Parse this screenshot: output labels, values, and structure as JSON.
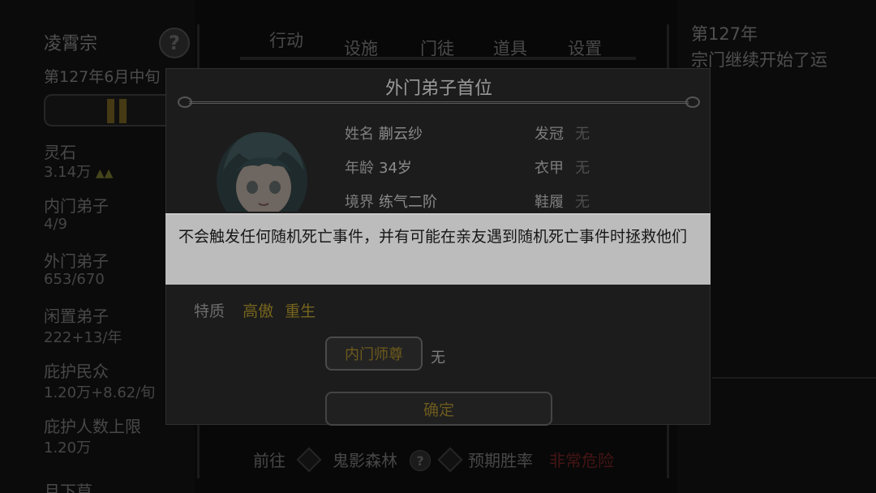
{
  "sidebar": {
    "sect_name": "凌霄宗",
    "date": "第127年6月中旬",
    "stats": [
      {
        "label": "灵石",
        "value": "3.14万",
        "trend": "▲▲"
      },
      {
        "label": "内门弟子",
        "value": "4/9"
      },
      {
        "label": "外门弟子",
        "value": "653/670"
      },
      {
        "label": "闲置弟子",
        "value": "222+13/年"
      },
      {
        "label": "庇护民众",
        "value": "1.20万+8.62/旬"
      },
      {
        "label": "庇护人数上限",
        "value": "1.20万"
      },
      {
        "label": "月下草",
        "value": ""
      }
    ]
  },
  "nav": {
    "tabs": [
      "行动",
      "设施",
      "门徒",
      "道具",
      "设置"
    ]
  },
  "log": {
    "title": "第127年",
    "message": "宗门继续开始了运"
  },
  "bottom": {
    "go_label": "前往",
    "location": "鬼影森林",
    "win_rate_label": "预期胜率",
    "win_rate_value": "非常危险"
  },
  "modal": {
    "title": "外门弟子首位",
    "info_left": [
      {
        "label": "姓名",
        "value": "蒯云纱"
      },
      {
        "label": "年龄",
        "value": "34岁"
      },
      {
        "label": "境界",
        "value": "练气二阶"
      }
    ],
    "info_right": [
      {
        "label": "发冠",
        "value": "无"
      },
      {
        "label": "衣甲",
        "value": "无"
      },
      {
        "label": "鞋履",
        "value": "无"
      }
    ],
    "traits_label": "特质",
    "traits": [
      "高傲",
      "重生"
    ],
    "master_button": "内门师尊",
    "master_value": "无",
    "confirm_button": "确定"
  },
  "tooltip": {
    "text": "不会触发任何随机死亡事件，并有可能在亲友遇到随机死亡事件时拯救他们"
  }
}
